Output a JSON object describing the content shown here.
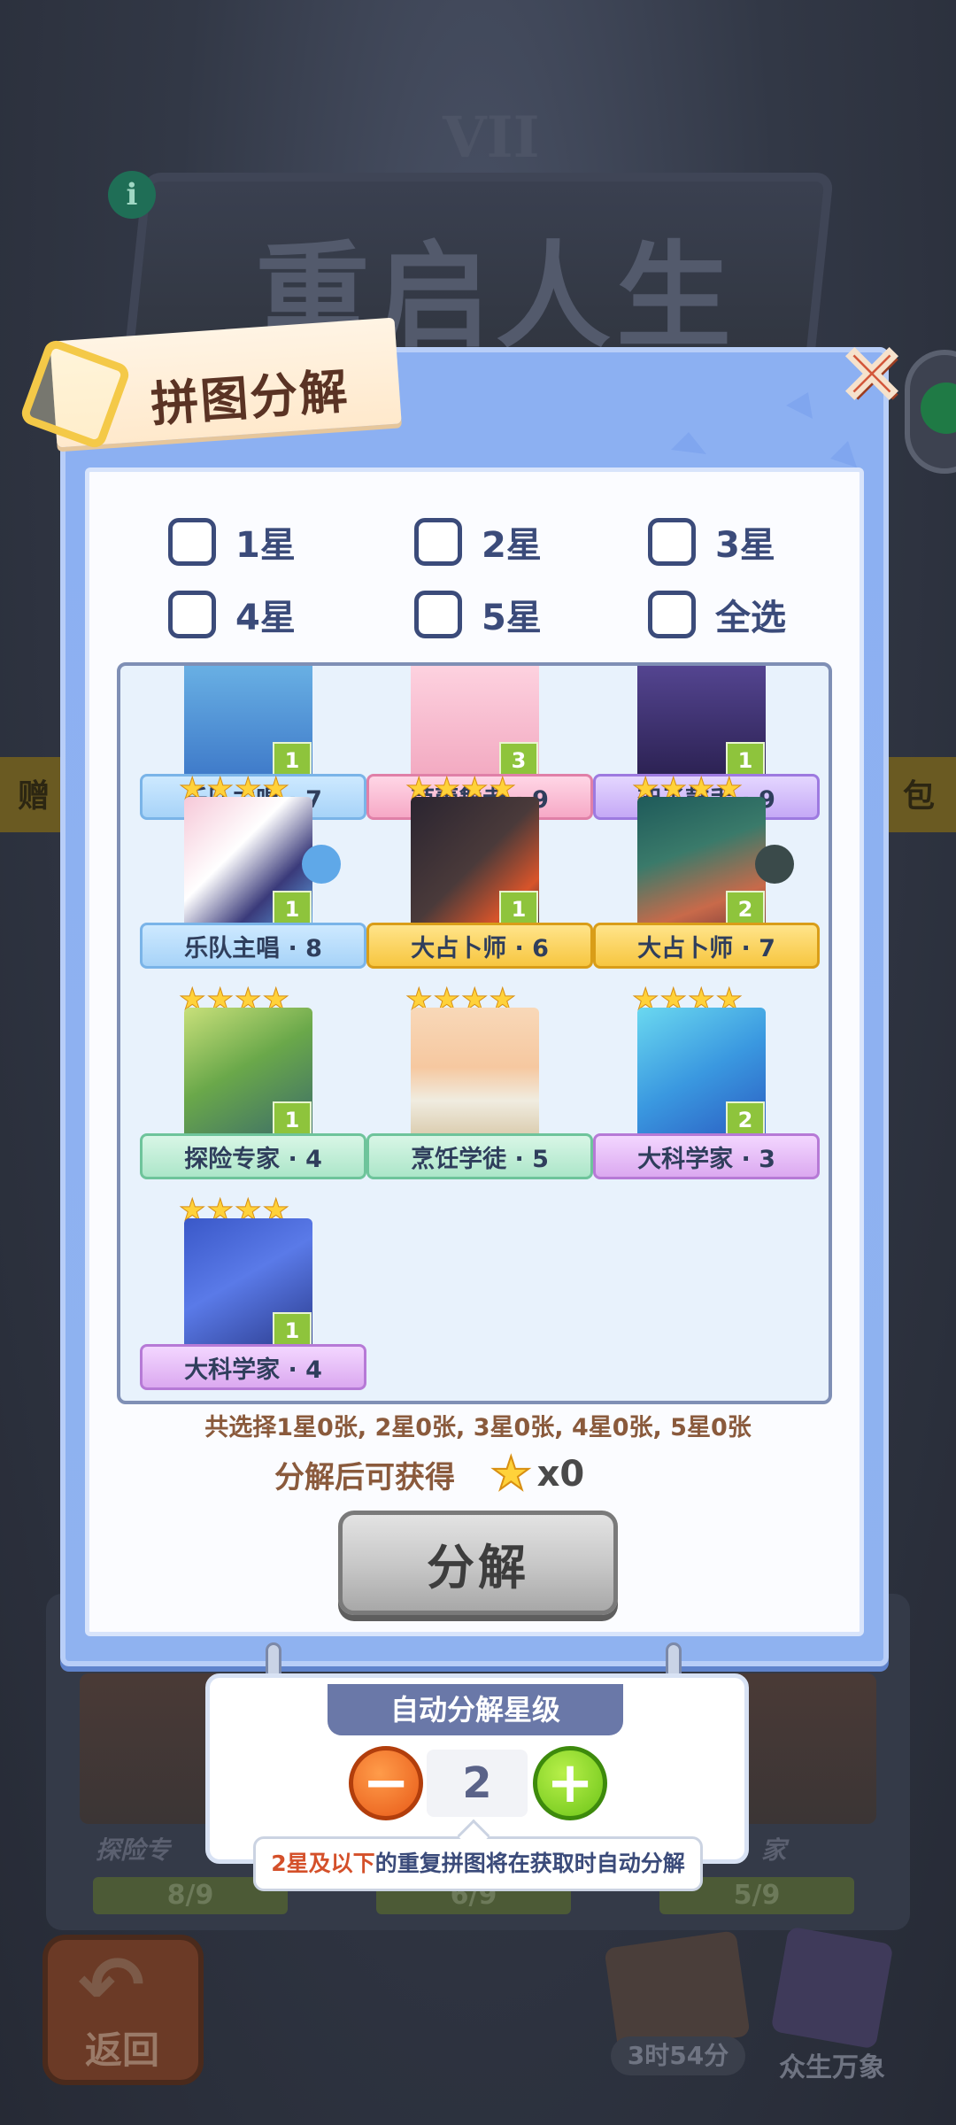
{
  "background": {
    "title": "重启人生",
    "roman_numeral": "VII",
    "side_left": "赠",
    "side_right": "包",
    "cards": [
      {
        "label": "探险专",
        "progress": "8/9"
      },
      {
        "label": "",
        "progress": "6/9"
      },
      {
        "label": "家",
        "progress": "5/9"
      }
    ],
    "back_label": "返回",
    "timer": "3时54分",
    "book_label": "众生万象"
  },
  "dialog": {
    "title": "拼图分解",
    "close_label": "✕",
    "filters": [
      {
        "label": "1星",
        "checked": false
      },
      {
        "label": "2星",
        "checked": false
      },
      {
        "label": "3星",
        "checked": false
      },
      {
        "label": "4星",
        "checked": false
      },
      {
        "label": "5星",
        "checked": false
      },
      {
        "label": "全选",
        "checked": false
      }
    ],
    "pieces": [
      {
        "name": "乐队主唱 · 7",
        "count": "1",
        "stars": 4,
        "ribbon": "blue"
      },
      {
        "name": "芭蕾舞者 · 9",
        "count": "3",
        "stars": 4,
        "ribbon": "pink"
      },
      {
        "name": "架子鼓手 · 9",
        "count": "1",
        "stars": 4,
        "ribbon": "purple"
      },
      {
        "name": "乐队主唱 · 8",
        "count": "1",
        "stars": 4,
        "ribbon": "blue"
      },
      {
        "name": "大占卜师 · 6",
        "count": "1",
        "stars": 4,
        "ribbon": "gold"
      },
      {
        "name": "大占卜师 · 7",
        "count": "2",
        "stars": 4,
        "ribbon": "gold"
      },
      {
        "name": "探险专家 · 4",
        "count": "1",
        "stars": 4,
        "ribbon": "green"
      },
      {
        "name": "烹饪学徒 · 5",
        "count": "",
        "stars": 4,
        "ribbon": "green"
      },
      {
        "name": "大科学家 · 3",
        "count": "2",
        "stars": 4,
        "ribbon": "violet"
      },
      {
        "name": "大科学家 · 4",
        "count": "1",
        "stars": 4,
        "ribbon": "violet"
      }
    ],
    "summary": "共选择1星0张, 2星0张, 3星0张, 4星0张, 5星0张",
    "reward_label": "分解后可获得",
    "reward_value": "x0",
    "decompose_label": "分解"
  },
  "auto_decompose": {
    "title": "自动分解星级",
    "minus_label": "−",
    "plus_label": "+",
    "level": "2",
    "hint_highlight": "2星及以下",
    "hint_rest": "的重复拼图将在获取时自动分解"
  },
  "colors": {
    "panel_blue": "#8cb0f2",
    "title_brown": "#5a3324",
    "checkbox_navy": "#3b4b7a",
    "star_yellow": "#ffd23a",
    "count_green": "#8ec43c",
    "minus_orange": "#e85a18",
    "plus_green": "#6cc418"
  }
}
